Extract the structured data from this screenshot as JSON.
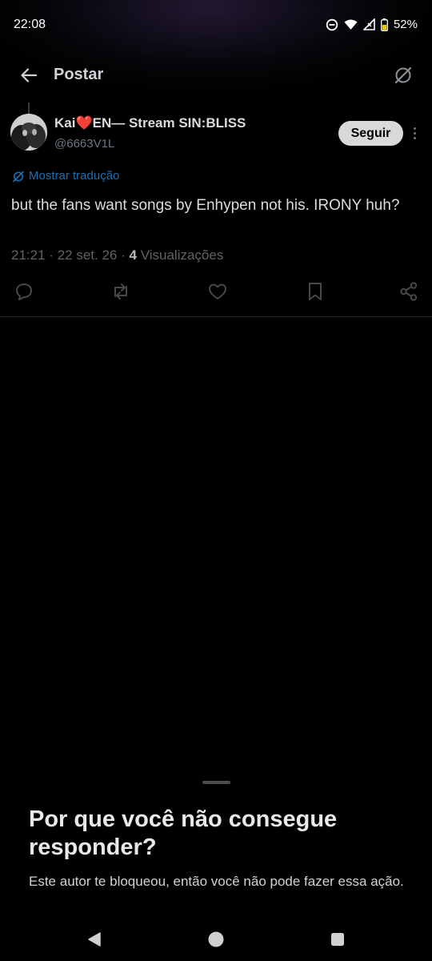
{
  "status_bar": {
    "time": "22:08",
    "battery": "52%",
    "icons": [
      "do-not-disturb-icon",
      "wifi-icon",
      "cell-signal-icon",
      "battery-icon"
    ]
  },
  "header": {
    "title": "Postar",
    "back_icon": "arrow-left-icon",
    "grok_icon": "grok-icon"
  },
  "post": {
    "display_name": "Kai❤️EN— Stream SIN:BLISS",
    "handle": "@6663V1L",
    "follow_label": "Seguir",
    "translate_label": "Mostrar tradução",
    "text": "but the fans want songs by Enhypen not his.  IRONY huh?",
    "time": "21:21",
    "date": "22 set. 26",
    "views_count": "4",
    "views_label": "Visualizações",
    "separator": "·"
  },
  "actions": [
    "reply-icon",
    "repost-icon",
    "like-icon",
    "bookmark-icon",
    "share-icon"
  ],
  "sheet": {
    "title": "Por que você não consegue responder?",
    "body": "Este autor te bloqueou, então você não pode fazer essa ação."
  },
  "nav_bar": [
    "back-triangle-icon",
    "home-circle-icon",
    "recents-square-icon"
  ],
  "colors": {
    "background": "#000000",
    "link": "#1d6fb0",
    "follow_bg": "#d9d9d9",
    "muted": "#6e767d"
  }
}
